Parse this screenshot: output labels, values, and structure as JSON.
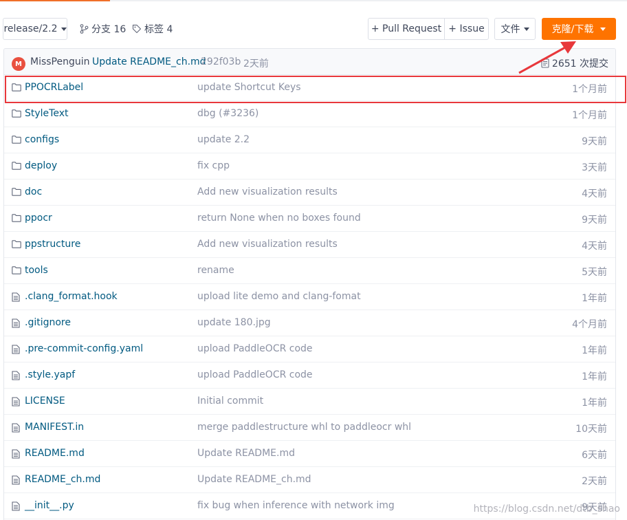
{
  "toolbar": {
    "branch": "release/2.2",
    "branches_label": "分支 16",
    "tags_label": "标签 4",
    "pull_request": "+ Pull Request",
    "issue": "+ Issue",
    "file": "文件",
    "clone": "克隆/下载"
  },
  "commit": {
    "avatar_letter": "M",
    "author": "MissPenguin",
    "message": "Update README_ch.md",
    "sha": "292f03b",
    "time": "2天前",
    "count": "2651 次提交"
  },
  "files": [
    {
      "name": "PPOCRLabel",
      "type": "folder",
      "message": "update Shortcut Keys",
      "time": "1个月前"
    },
    {
      "name": "StyleText",
      "type": "folder",
      "message": "dbg (#3236)",
      "time": "1个月前"
    },
    {
      "name": "configs",
      "type": "folder",
      "message": "update 2.2",
      "time": "9天前"
    },
    {
      "name": "deploy",
      "type": "folder",
      "message": "fix cpp",
      "time": "3天前"
    },
    {
      "name": "doc",
      "type": "folder",
      "message": "Add new visualization results",
      "time": "4天前"
    },
    {
      "name": "ppocr",
      "type": "folder",
      "message": "return None when no boxes found",
      "time": "9天前"
    },
    {
      "name": "ppstructure",
      "type": "folder",
      "message": "Add new visualization results",
      "time": "4天前"
    },
    {
      "name": "tools",
      "type": "folder",
      "message": "rename",
      "time": "5天前"
    },
    {
      "name": ".clang_format.hook",
      "type": "file",
      "message": "upload lite demo and clang-fomat",
      "time": "1年前"
    },
    {
      "name": ".gitignore",
      "type": "file",
      "message": "update 180.jpg",
      "time": "4个月前"
    },
    {
      "name": ".pre-commit-config.yaml",
      "type": "file",
      "message": "upload PaddleOCR code",
      "time": "1年前"
    },
    {
      "name": ".style.yapf",
      "type": "file",
      "message": "upload PaddleOCR code",
      "time": "1年前"
    },
    {
      "name": "LICENSE",
      "type": "file",
      "message": "Initial commit",
      "time": "1年前"
    },
    {
      "name": "MANIFEST.in",
      "type": "file",
      "message": "merge paddlestructure whl to paddleocr whl",
      "time": "10天前"
    },
    {
      "name": "README.md",
      "type": "file",
      "message": "Update README.md",
      "time": "6天前"
    },
    {
      "name": "README_ch.md",
      "type": "file",
      "message": "Update README_ch.md",
      "time": "2天前"
    },
    {
      "name": "__init__.py",
      "type": "file",
      "message": "fix bug when inference with network img",
      "time": "9天前"
    }
  ],
  "watermark": "https://blog.csdn.net/dtb_shao",
  "colors": {
    "accent": "#fe7300",
    "link": "#005980",
    "annotation": "#e8373b"
  }
}
